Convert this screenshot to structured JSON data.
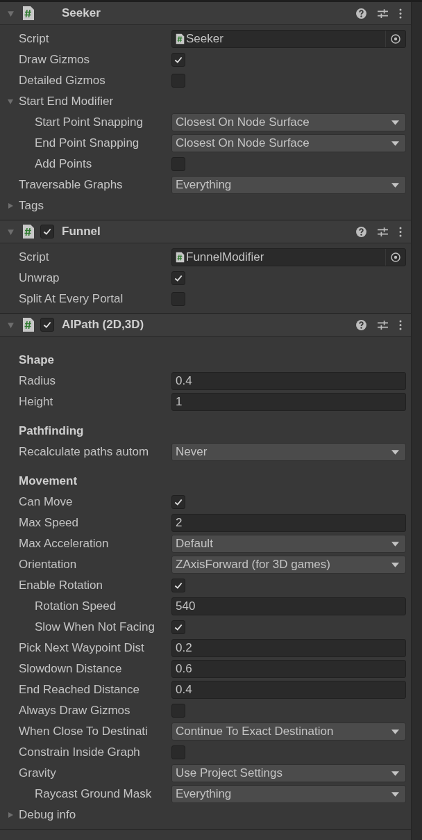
{
  "components": [
    {
      "title": "Seeker",
      "expanded": true,
      "rows": [
        {
          "kind": "object",
          "label": "Script",
          "value": "Seeker"
        },
        {
          "kind": "toggle",
          "label": "Draw Gizmos",
          "checked": true
        },
        {
          "kind": "toggle",
          "label": "Detailed Gizmos",
          "checked": false
        },
        {
          "kind": "foldout",
          "label": "Start End Modifier",
          "expanded": true,
          "children": [
            {
              "kind": "dropdown",
              "label": "Start Point Snapping",
              "value": "Closest On Node Surface"
            },
            {
              "kind": "dropdown",
              "label": "End Point Snapping",
              "value": "Closest On Node Surface"
            },
            {
              "kind": "toggle",
              "label": "Add Points",
              "checked": false
            }
          ]
        },
        {
          "kind": "dropdown",
          "label": "Traversable Graphs",
          "value": "Everything"
        },
        {
          "kind": "foldout",
          "label": "Tags",
          "expanded": false
        }
      ]
    },
    {
      "title": "Funnel",
      "expanded": true,
      "enabled": true,
      "rows": [
        {
          "kind": "object",
          "label": "Script",
          "value": "FunnelModifier"
        },
        {
          "kind": "toggle",
          "label": "Unwrap",
          "checked": true
        },
        {
          "kind": "toggle",
          "label": "Split At Every Portal",
          "checked": false
        }
      ]
    },
    {
      "title": "AIPath (2D,3D)",
      "expanded": true,
      "enabled": true,
      "rows": [
        {
          "kind": "heading",
          "label": "Shape"
        },
        {
          "kind": "text",
          "label": "Radius",
          "value": "0.4"
        },
        {
          "kind": "text",
          "label": "Height",
          "value": "1"
        },
        {
          "kind": "heading",
          "label": "Pathfinding"
        },
        {
          "kind": "dropdown",
          "label": "Recalculate paths autom",
          "value": "Never"
        },
        {
          "kind": "heading",
          "label": "Movement"
        },
        {
          "kind": "toggle",
          "label": "Can Move",
          "checked": true
        },
        {
          "kind": "text",
          "label": "Max Speed",
          "value": "2"
        },
        {
          "kind": "dropdown",
          "label": "Max Acceleration",
          "value": "Default"
        },
        {
          "kind": "dropdown",
          "label": "Orientation",
          "value": "ZAxisForward (for 3D games)"
        },
        {
          "kind": "toggle",
          "label": "Enable Rotation",
          "checked": true,
          "children": [
            {
              "kind": "text",
              "label": "Rotation Speed",
              "value": "540"
            },
            {
              "kind": "toggle",
              "label": "Slow When Not Facing",
              "checked": true
            }
          ]
        },
        {
          "kind": "text",
          "label": "Pick Next Waypoint Dist",
          "value": "0.2"
        },
        {
          "kind": "text",
          "label": "Slowdown Distance",
          "value": "0.6"
        },
        {
          "kind": "text",
          "label": "End Reached Distance",
          "value": "0.4"
        },
        {
          "kind": "toggle",
          "label": "Always Draw Gizmos",
          "checked": false
        },
        {
          "kind": "dropdown",
          "label": "When Close To Destinati",
          "value": "Continue To Exact Destination"
        },
        {
          "kind": "toggle",
          "label": "Constrain Inside Graph",
          "checked": false
        },
        {
          "kind": "dropdown",
          "label": "Gravity",
          "value": "Use Project Settings",
          "children": [
            {
              "kind": "dropdown",
              "label": "Raycast Ground Mask",
              "value": "Everything"
            }
          ]
        },
        {
          "kind": "foldout",
          "label": "Debug info",
          "expanded": false
        }
      ]
    }
  ]
}
